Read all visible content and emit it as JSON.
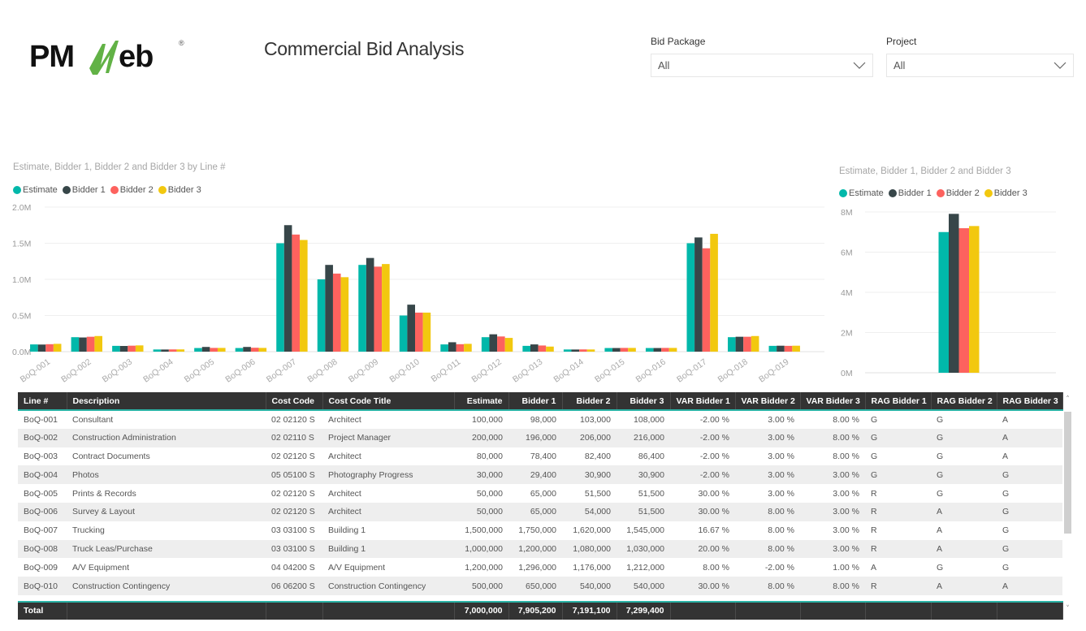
{
  "header": {
    "logo_text_left": "PM",
    "logo_text_right": "eb",
    "logo_trademark": "®",
    "title": "Commercial Bid Analysis"
  },
  "slicers": [
    {
      "label": "Bid Package",
      "value": "All"
    },
    {
      "label": "Project",
      "value": "All"
    }
  ],
  "colors": {
    "estimate": "#01B8AA",
    "bidder1": "#374649",
    "bidder2": "#FD625E",
    "bidder3": "#F2C80F",
    "header_bg": "#333333",
    "accent": "#2BB3A6"
  },
  "chart_data": [
    {
      "type": "bar",
      "title": "Estimate, Bidder 1, Bidder 2 and Bidder 3 by Line #",
      "xlabel": "",
      "ylabel": "",
      "ylim": [
        0,
        2000000
      ],
      "yticks": [
        "0.0M",
        "0.5M",
        "1.0M",
        "1.5M",
        "2.0M"
      ],
      "ytick_values": [
        0,
        500000,
        1000000,
        1500000,
        2000000
      ],
      "grid": true,
      "legend": "top-left",
      "categories": [
        "BoQ-001",
        "BoQ-002",
        "BoQ-003",
        "BoQ-004",
        "BoQ-005",
        "BoQ-006",
        "BoQ-007",
        "BoQ-008",
        "BoQ-009",
        "BoQ-010",
        "BoQ-011",
        "BoQ-012",
        "BoQ-013",
        "BoQ-014",
        "BoQ-015",
        "BoQ-016",
        "BoQ-017",
        "BoQ-018",
        "BoQ-019"
      ],
      "series": [
        {
          "name": "Estimate",
          "values": [
            100000,
            200000,
            80000,
            30000,
            50000,
            50000,
            1500000,
            1000000,
            1200000,
            500000,
            100000,
            200000,
            80000,
            30000,
            50000,
            50000,
            1500000,
            200000,
            80000
          ]
        },
        {
          "name": "Bidder 1",
          "values": [
            98000,
            196000,
            78400,
            29400,
            65000,
            65000,
            1750000,
            1200000,
            1296000,
            650000,
            130000,
            240000,
            100000,
            29400,
            50000,
            50000,
            1580000,
            206000,
            82000
          ]
        },
        {
          "name": "Bidder 2",
          "values": [
            103000,
            206000,
            82400,
            30900,
            51500,
            54000,
            1620000,
            1080000,
            1176000,
            540000,
            103000,
            210000,
            85000,
            30900,
            51500,
            51500,
            1430000,
            206000,
            80000
          ]
        },
        {
          "name": "Bidder 3",
          "values": [
            108000,
            216000,
            86400,
            30900,
            51500,
            51500,
            1545000,
            1030000,
            1212000,
            540000,
            108000,
            190000,
            70000,
            30000,
            51500,
            51500,
            1630000,
            216000,
            82000
          ]
        }
      ]
    },
    {
      "type": "bar",
      "title": "Estimate, Bidder 1, Bidder 2 and Bidder 3",
      "xlabel": "",
      "ylabel": "",
      "ylim": [
        0,
        8000000
      ],
      "yticks": [
        "0M",
        "2M",
        "4M",
        "6M",
        "8M"
      ],
      "ytick_values": [
        0,
        2000000,
        4000000,
        6000000,
        8000000
      ],
      "grid": true,
      "legend": "top-left",
      "categories": [
        "Total"
      ],
      "series": [
        {
          "name": "Estimate",
          "values": [
            7000000
          ]
        },
        {
          "name": "Bidder 1",
          "values": [
            7905200
          ]
        },
        {
          "name": "Bidder 2",
          "values": [
            7191100
          ]
        },
        {
          "name": "Bidder 3",
          "values": [
            7299400
          ]
        }
      ]
    }
  ],
  "table": {
    "columns": [
      "Line #",
      "Description",
      "Cost Code",
      "Cost Code Title",
      "Estimate",
      "Bidder 1",
      "Bidder 2",
      "Bidder 3",
      "VAR Bidder 1",
      "VAR Bidder 2",
      "VAR Bidder 3",
      "RAG Bidder 1",
      "RAG Bidder 2",
      "RAG Bidder 3"
    ],
    "rows": [
      [
        "BoQ-001",
        "Consultant",
        "02 02120 S",
        "Architect",
        "100,000",
        "98,000",
        "103,000",
        "108,000",
        "-2.00 %",
        "3.00 %",
        "8.00 %",
        "G",
        "G",
        "A"
      ],
      [
        "BoQ-002",
        "Construction Administration",
        "02 02110 S",
        "Project Manager",
        "200,000",
        "196,000",
        "206,000",
        "216,000",
        "-2.00 %",
        "3.00 %",
        "8.00 %",
        "G",
        "G",
        "A"
      ],
      [
        "BoQ-003",
        "Contract Documents",
        "02 02120 S",
        "Architect",
        "80,000",
        "78,400",
        "82,400",
        "86,400",
        "-2.00 %",
        "3.00 %",
        "8.00 %",
        "G",
        "G",
        "A"
      ],
      [
        "BoQ-004",
        "Photos",
        "05 05100 S",
        "Photography Progress",
        "30,000",
        "29,400",
        "30,900",
        "30,900",
        "-2.00 %",
        "3.00 %",
        "3.00 %",
        "G",
        "G",
        "G"
      ],
      [
        "BoQ-005",
        "Prints & Records",
        "02 02120 S",
        "Architect",
        "50,000",
        "65,000",
        "51,500",
        "51,500",
        "30.00 %",
        "3.00 %",
        "3.00 %",
        "R",
        "G",
        "G"
      ],
      [
        "BoQ-006",
        "Survey & Layout",
        "02 02120 S",
        "Architect",
        "50,000",
        "65,000",
        "54,000",
        "51,500",
        "30.00 %",
        "8.00 %",
        "3.00 %",
        "R",
        "A",
        "G"
      ],
      [
        "BoQ-007",
        "Trucking",
        "03 03100 S",
        "Building 1",
        "1,500,000",
        "1,750,000",
        "1,620,000",
        "1,545,000",
        "16.67 %",
        "8.00 %",
        "3.00 %",
        "R",
        "A",
        "G"
      ],
      [
        "BoQ-008",
        "Truck Leas/Purchase",
        "03 03100 S",
        "Building 1",
        "1,000,000",
        "1,200,000",
        "1,080,000",
        "1,030,000",
        "20.00 %",
        "8.00 %",
        "3.00 %",
        "R",
        "A",
        "G"
      ],
      [
        "BoQ-009",
        "A/V Equipment",
        "04 04200 S",
        "A/V Equipment",
        "1,200,000",
        "1,296,000",
        "1,176,000",
        "1,212,000",
        "8.00 %",
        "-2.00 %",
        "1.00 %",
        "A",
        "G",
        "G"
      ],
      [
        "BoQ-010",
        "Construction Contingency",
        "06 06200 S",
        "Construction Contingency",
        "500,000",
        "650,000",
        "540,000",
        "540,000",
        "30.00 %",
        "8.00 %",
        "8.00 %",
        "R",
        "A",
        "A"
      ]
    ],
    "total": [
      "Total",
      "",
      "",
      "",
      "7,000,000",
      "7,905,200",
      "7,191,100",
      "7,299,400",
      "",
      "",
      "",
      "",
      "",
      ""
    ]
  },
  "scrollbar": {
    "up": "˄",
    "down": "˅"
  }
}
